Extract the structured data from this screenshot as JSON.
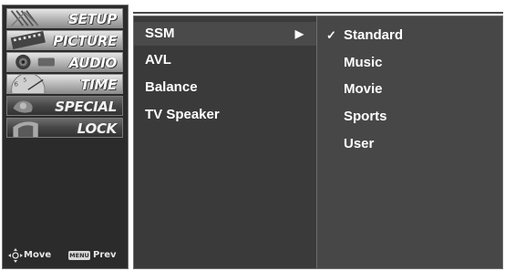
{
  "left_menu": {
    "items": [
      {
        "label": "SETUP",
        "icon": "setup-icon"
      },
      {
        "label": "PICTURE",
        "icon": "picture-icon"
      },
      {
        "label": "AUDIO",
        "icon": "audio-icon"
      },
      {
        "label": "TIME",
        "icon": "time-icon"
      },
      {
        "label": "SPECIAL",
        "icon": "special-icon"
      },
      {
        "label": "LOCK",
        "icon": "lock-icon"
      }
    ],
    "footer": {
      "move_label": "Move",
      "menu_key_label": "MENU",
      "prev_label": "Prev"
    }
  },
  "submenu": {
    "items": [
      {
        "label": "SSM",
        "arrow": "▶"
      },
      {
        "label": "AVL"
      },
      {
        "label": "Balance"
      },
      {
        "label": "TV Speaker"
      }
    ]
  },
  "options": {
    "check_mark": "✓",
    "items": [
      {
        "label": "Standard"
      },
      {
        "label": "Music"
      },
      {
        "label": "Movie"
      },
      {
        "label": "Sports"
      },
      {
        "label": "User"
      }
    ]
  },
  "colors": {
    "left_bg": "#2b2b2b",
    "submenu_bg": "#3a3a3a",
    "selected_bg": "#4a4a4a",
    "options_bg": "#474747",
    "text": "#ffffff"
  }
}
